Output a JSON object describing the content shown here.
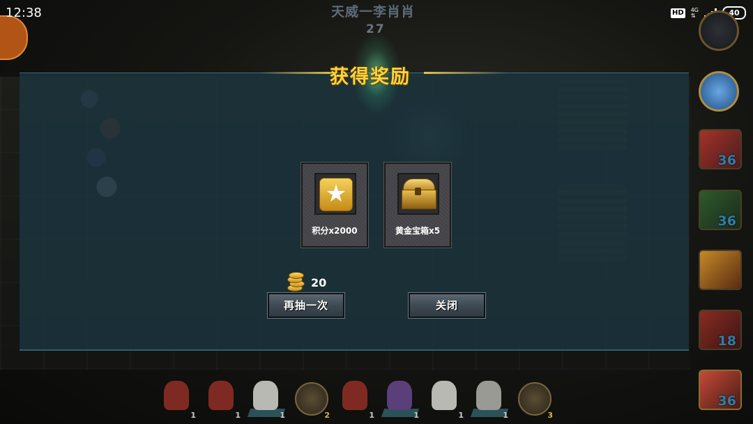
{
  "status_bar": {
    "time": "12:38",
    "hd": "HD",
    "network": "4G",
    "battery": "40"
  },
  "scene": {
    "player_name": "天威一李肖肖",
    "score": "27",
    "right_panel": {
      "counts": [
        "36",
        "36",
        "18",
        "36"
      ]
    },
    "unit_bar": {
      "slots": [
        {
          "type": "red-cavalry",
          "count": "1"
        },
        {
          "type": "red-cavalry",
          "count": "1"
        },
        {
          "type": "white-horse",
          "count": "1"
        },
        {
          "type": "hourglass",
          "count": "2"
        },
        {
          "type": "red-cavalry",
          "count": "1"
        },
        {
          "type": "purple-cavalry",
          "count": "1"
        },
        {
          "type": "white-horse",
          "count": "1"
        },
        {
          "type": "white-horse",
          "count": "1"
        },
        {
          "type": "hourglass",
          "count": "3"
        }
      ]
    }
  },
  "modal": {
    "title": "获得奖励",
    "rewards": [
      {
        "icon": "star-icon",
        "label": "积分x2000"
      },
      {
        "icon": "treasure-chest-icon",
        "label": "黄金宝箱x5"
      }
    ],
    "cost": {
      "icon": "gold-coins-icon",
      "amount": "20"
    },
    "buttons": {
      "draw_again": "再抽一次",
      "close": "关闭"
    }
  },
  "colors": {
    "title_gold": "#ffd33d",
    "overlay_teal": "#1b343e",
    "count_blue": "#2e7ea8"
  }
}
